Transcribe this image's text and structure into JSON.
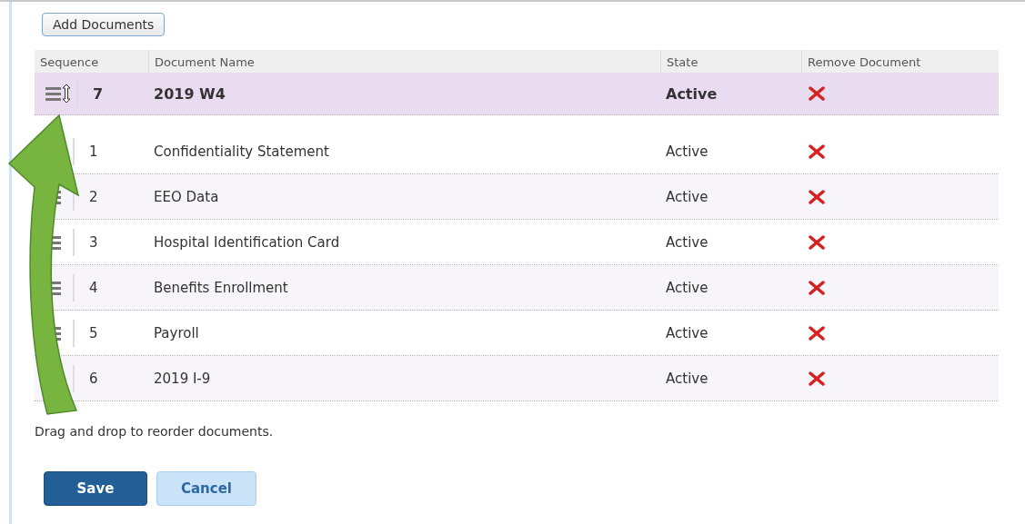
{
  "add_button": "Add Documents",
  "table": {
    "columns": [
      "Sequence",
      "Document Name",
      "State",
      "Remove Document"
    ],
    "rows": [
      {
        "sequence": "7",
        "name": "2019 W4",
        "state": "Active",
        "dragging": true,
        "handle": true
      },
      {
        "sequence": "1",
        "name": "Confidentiality Statement",
        "state": "Active",
        "dragging": false,
        "handle": false
      },
      {
        "sequence": "2",
        "name": "EEO Data",
        "state": "Active",
        "dragging": false,
        "handle": true
      },
      {
        "sequence": "3",
        "name": "Hospital Identification Card",
        "state": "Active",
        "dragging": false,
        "handle": true
      },
      {
        "sequence": "4",
        "name": "Benefits Enrollment",
        "state": "Active",
        "dragging": false,
        "handle": true
      },
      {
        "sequence": "5",
        "name": "Payroll",
        "state": "Active",
        "dragging": false,
        "handle": true
      },
      {
        "sequence": "6",
        "name": "2019 I-9",
        "state": "Active",
        "dragging": false,
        "handle": false
      }
    ]
  },
  "hint": "Drag and drop to reorder documents.",
  "buttons": [
    {
      "label": "Save",
      "kind": "primary"
    },
    {
      "label": "Cancel",
      "kind": "secondary"
    }
  ]
}
